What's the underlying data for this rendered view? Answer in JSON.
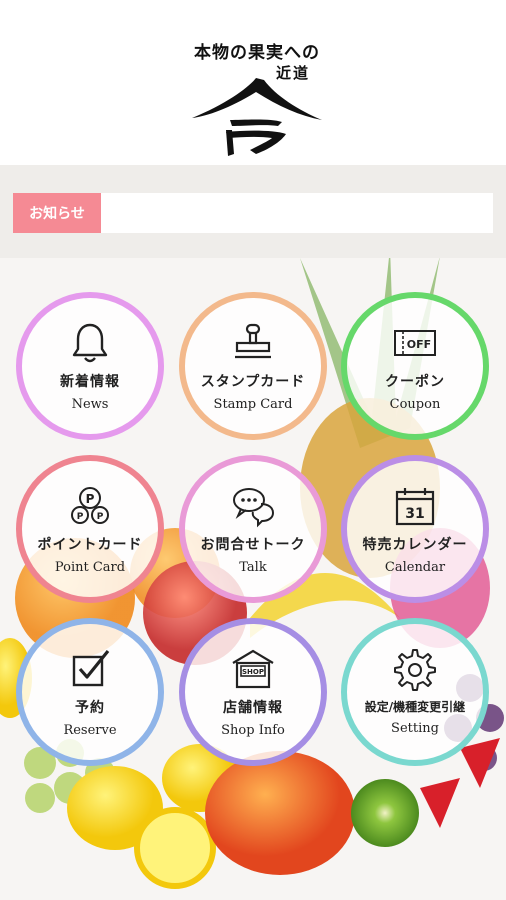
{
  "header": {
    "tagline_line1": "本物の果実への",
    "tagline_line2": "近道",
    "logo_glyph": "今"
  },
  "news": {
    "label": "お知らせ",
    "text": ""
  },
  "colors": {
    "news_label": "#f58a94",
    "news_area": "#efedea",
    "ring_news": "#e59aed",
    "ring_stamp": "#f3b98c",
    "ring_coupon": "#66d86a",
    "ring_point": "#ef8490",
    "ring_talk": "#e99ad7",
    "ring_calendar": "#bb8ee6",
    "ring_reserve": "#8fb4e8",
    "ring_shop": "#a58ee4",
    "ring_setting": "#7ad8cf"
  },
  "menu": {
    "news": {
      "ja": "新着情報",
      "en": "News",
      "icon": "bell-icon"
    },
    "stamp": {
      "ja": "スタンプカード",
      "en": "Stamp Card",
      "icon": "stamp-icon"
    },
    "coupon": {
      "ja": "クーポン",
      "en": "Coupon",
      "icon": "coupon-icon",
      "icon_text": "OFF"
    },
    "point": {
      "ja": "ポイントカード",
      "en": "Point Card",
      "icon": "point-coins-icon",
      "icon_text": "P"
    },
    "talk": {
      "ja": "お問合せトーク",
      "en": "Talk",
      "icon": "chat-bubbles-icon"
    },
    "calendar": {
      "ja": "特売カレンダー",
      "en": "Calendar",
      "icon": "calendar-icon",
      "icon_text": "31"
    },
    "reserve": {
      "ja": "予約",
      "en": "Reserve",
      "icon": "checkbox-icon"
    },
    "shop": {
      "ja": "店舗情報",
      "en": "Shop Info",
      "icon": "shop-icon",
      "icon_text": "SHOP"
    },
    "setting": {
      "ja": "設定/機種変更引継",
      "en": "Setting",
      "icon": "gear-icon"
    }
  }
}
